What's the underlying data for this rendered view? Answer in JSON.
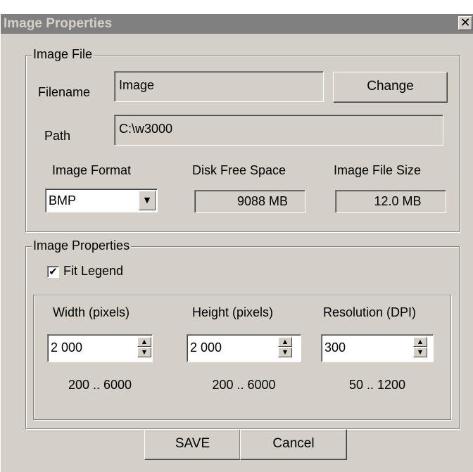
{
  "window": {
    "title": "Image Properties",
    "close_glyph": "✕"
  },
  "image_file": {
    "group_label": "Image File",
    "filename_label": "Filename",
    "filename_value": "Image",
    "change_button": "Change",
    "path_label": "Path",
    "path_value": "C:\\w3000",
    "format_label": "Image Format",
    "format_value": "BMP",
    "disk_free_label": "Disk Free Space",
    "disk_free_value": "9088 MB",
    "file_size_label": "Image File Size",
    "file_size_value": "12.0 MB"
  },
  "image_properties": {
    "group_label": "Image Properties",
    "fit_legend_label": "Fit Legend",
    "fit_legend_checked": true,
    "width_label": "Width  (pixels)",
    "width_value": "2 000",
    "width_range": "200 .. 6000",
    "height_label": "Height  (pixels)",
    "height_value": "2 000",
    "height_range": "200 .. 6000",
    "resolution_label": "Resolution (DPI)",
    "resolution_value": "300",
    "resolution_range": "50 .. 1200"
  },
  "buttons": {
    "save": "SAVE",
    "cancel": "Cancel"
  },
  "icons": {
    "check": "✔",
    "dropdown": "▼",
    "spin_up": "▲",
    "spin_down": "▼"
  }
}
